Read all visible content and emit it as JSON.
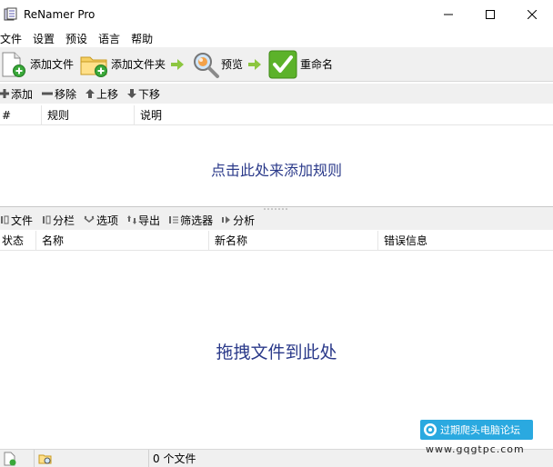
{
  "window": {
    "title": "ReNamer Pro"
  },
  "menu": {
    "items": [
      "文件",
      "设置",
      "预设",
      "语言",
      "帮助"
    ]
  },
  "toolbar": {
    "add_files": "添加文件",
    "add_folders": "添加文件夹",
    "preview": "预览",
    "rename": "重命名"
  },
  "rules_toolbar": {
    "add": "添加",
    "remove": "移除",
    "up": "上移",
    "down": "下移"
  },
  "rules_table": {
    "columns": [
      "#",
      "规则",
      "说明"
    ],
    "hint": "点击此处来添加规则"
  },
  "files_toolbar": {
    "files": "文件",
    "columns": "分栏",
    "options": "选项",
    "export": "导出",
    "filters": "筛选器",
    "analyze": "分析"
  },
  "files_table": {
    "columns": [
      "状态",
      "名称",
      "新名称",
      "错误信息"
    ],
    "hint": "拖拽文件到此处"
  },
  "status": {
    "file_count": "0 个文件"
  },
  "watermark": {
    "title": "过期爬头电脑论坛",
    "url": "www.gqgtpc.com"
  },
  "colors": {
    "hint_text": "#2b3a8a",
    "toolbar_bg": "#f0f0f0",
    "rename_green": "#5cb22a",
    "watermark_blue": "#2aa9e0"
  }
}
